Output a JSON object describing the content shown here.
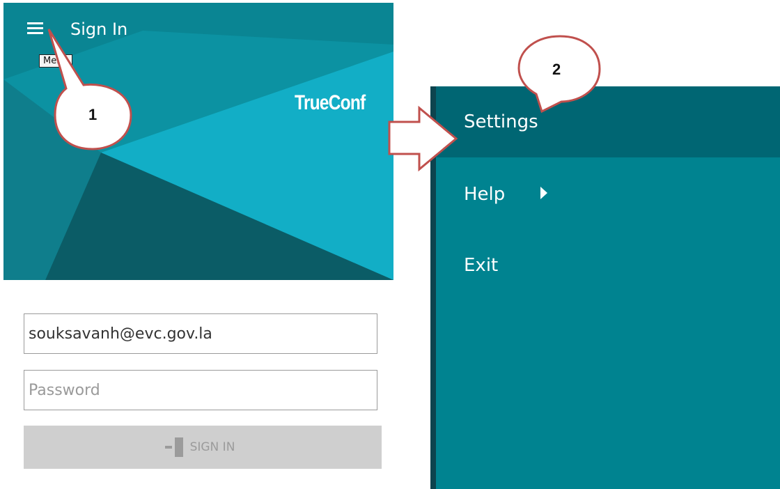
{
  "login": {
    "title": "Sign In",
    "tooltip": "Menu",
    "brand": "TrueConf",
    "email_value": "souksavanh@evc.gov.la",
    "password_placeholder": "Password",
    "sign_in_label": "SIGN IN"
  },
  "menu": {
    "items": [
      {
        "label": "Settings"
      },
      {
        "label": "Help"
      },
      {
        "label": "Exit"
      }
    ]
  },
  "callouts": [
    {
      "label": "1"
    },
    {
      "label": "2"
    }
  ],
  "colors": {
    "banner_dark": "#0b5c66",
    "banner_mid": "#0b8a98",
    "banner_light": "#12aec6",
    "menu_bg": "#008390",
    "menu_selected": "#006673",
    "callout_stroke": "#c0504d"
  },
  "icons": [
    "menu-icon",
    "chevron-right-icon",
    "sign-in-door-icon",
    "arrow-right-icon"
  ]
}
